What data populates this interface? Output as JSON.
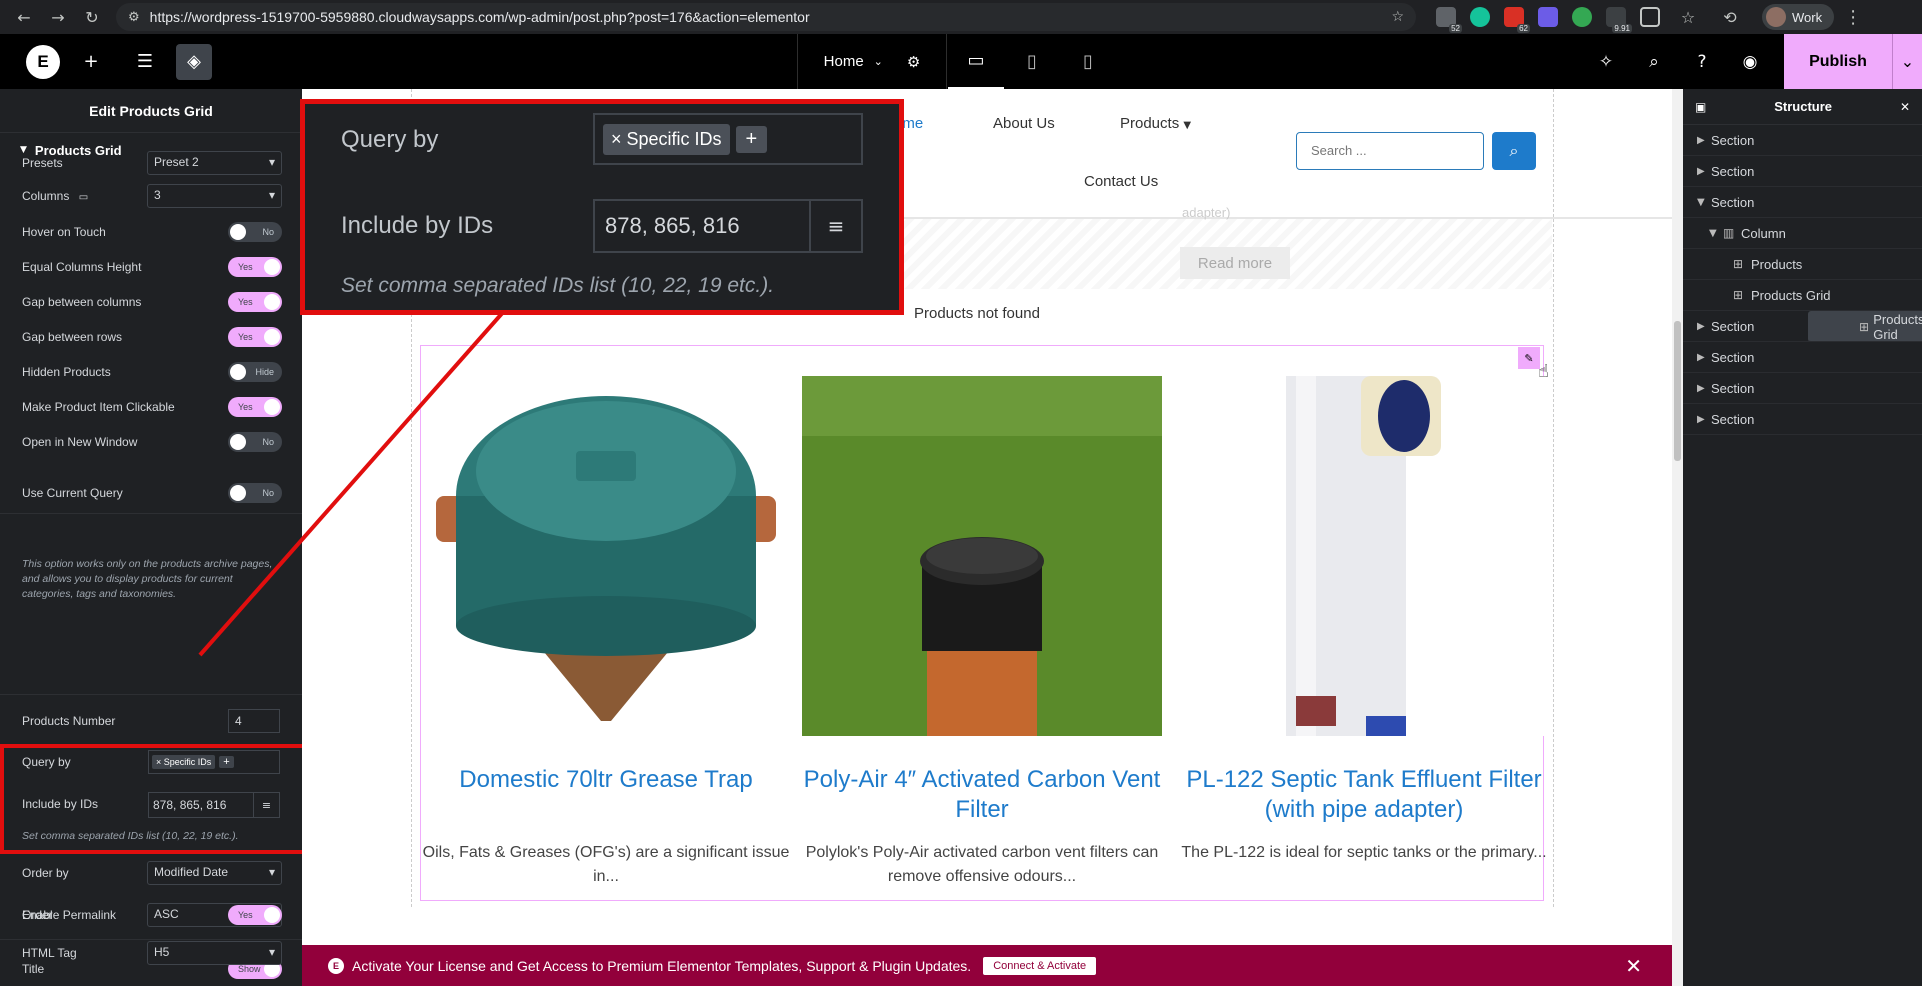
{
  "browser": {
    "url": "https://wordpress-1519700-5959880.cloudwaysapps.com/wp-admin/post.php?post=176&action=elementor",
    "ext_badges": [
      "52",
      "62",
      "9.91"
    ],
    "profile": "Work"
  },
  "topbar": {
    "page": "Home",
    "publish": "Publish"
  },
  "panel": {
    "title": "Edit Products Grid",
    "section": "Products Grid",
    "presets_label": "Presets",
    "presets_value": "Preset 2",
    "columns_label": "Columns",
    "columns_value": "3",
    "hover_label": "Hover on Touch",
    "hover_value": "No",
    "equal_label": "Equal Columns Height",
    "equal_value": "Yes",
    "gapcol_label": "Gap between columns",
    "gapcol_value": "Yes",
    "gaprow_label": "Gap between rows",
    "gaprow_value": "Yes",
    "hidden_label": "Hidden Products",
    "hidden_value": "Hide",
    "clickable_label": "Make Product Item Clickable",
    "clickable_value": "Yes",
    "newwin_label": "Open in New Window",
    "newwin_value": "No",
    "usecur_label": "Use Current Query",
    "usecur_value": "No",
    "usecur_hint": "This option works only on the products archive pages, and allows you to display products for current categories, tags and taxonomies.",
    "prodnum_label": "Products Number",
    "prodnum_value": "4",
    "queryby_label": "Query by",
    "queryby_tag": "× Specific IDs",
    "queryby_plus": "+",
    "ids_label": "Include by IDs",
    "ids_value": "878, 865, 816",
    "ids_hint": "Set comma separated IDs list (10, 22, 19 etc.).",
    "orderby_label": "Order by",
    "orderby_value": "Modified Date",
    "order_label": "Order",
    "order_value": "ASC",
    "title_label": "Title",
    "title_value": "Show",
    "permalink_label": "Enable Permalink",
    "permalink_value": "Yes",
    "htmltag_label": "HTML Tag",
    "htmltag_value": "H5"
  },
  "site": {
    "menu": [
      "ome",
      "About Us",
      "Products",
      "Contact Us"
    ],
    "search_placeholder": "Search ...",
    "adapter_text": "adapter)",
    "read_more": "Read more",
    "not_found": "Products not found",
    "products": [
      {
        "title": "Domestic 70ltr Grease Trap",
        "desc": "Oils, Fats & Greases (OFG's) are a significant issue in..."
      },
      {
        "title": "Poly-Air 4″ Activated Carbon Vent Filter",
        "desc": "Polylok's Poly-Air activated carbon vent filters can remove offensive odours..."
      },
      {
        "title": "PL-122 Septic Tank Effluent Filter (with pipe adapter)",
        "desc": "The PL-122 is ideal for septic tanks or the primary..."
      }
    ],
    "promo": "Activate Your License and Get Access to Premium Elementor Templates, Support & Plugin Updates.",
    "promo_btn": "Connect & Activate"
  },
  "structure": {
    "title": "Structure",
    "items": [
      {
        "label": "Section"
      },
      {
        "label": "Section"
      },
      {
        "label": "Section"
      },
      {
        "label": "Column"
      },
      {
        "label": "Products"
      },
      {
        "label": "Products Grid"
      },
      {
        "label": "Products Grid"
      },
      {
        "label": "Section"
      },
      {
        "label": "Section"
      },
      {
        "label": "Section"
      },
      {
        "label": "Section"
      }
    ]
  },
  "colors": {
    "accent": "#f0abfc",
    "link": "#1e7bcb",
    "highlight": "#e10e0e",
    "promo": "#92003b"
  }
}
